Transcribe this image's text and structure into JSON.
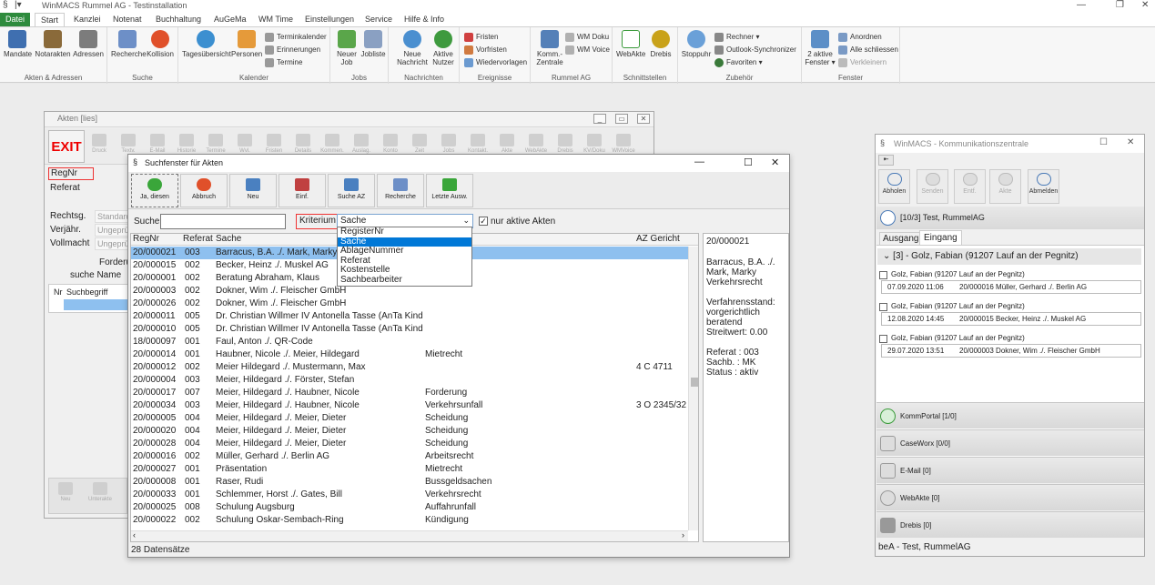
{
  "app": {
    "title": "WinMACS Rummel AG - Testinstallation",
    "tabs": [
      "Datei",
      "Start",
      "Kanzlei",
      "Notenat",
      "Buchhaltung",
      "AuGeMa",
      "WM Time",
      "Einstellungen",
      "Service",
      "Hilfe & Info"
    ]
  },
  "ribbon": {
    "akten_group": {
      "label": "Akten & Adressen",
      "buttons": [
        "Mandate",
        "Notarakten",
        "Adressen"
      ]
    },
    "suche_group": {
      "label": "Suche",
      "buttons": [
        "Recherche",
        "Kollision"
      ]
    },
    "kalender_group": {
      "label": "Kalender",
      "buttons": [
        "Tagesübersicht",
        "Personen"
      ],
      "small": [
        "Terminkalender",
        "Erinnerungen",
        "Termine"
      ]
    },
    "jobs_group": {
      "label": "Jobs",
      "buttons": [
        "Neuer Job",
        "Jobliste"
      ]
    },
    "nachrichten_group": {
      "label": "Nachrichten",
      "buttons": [
        "Neue Nachricht",
        "Aktive Nutzer"
      ]
    },
    "ereignisse_group": {
      "label": "Ereignisse",
      "small": [
        "Fristen",
        "Vorfristen",
        "Wiedervorlagen"
      ]
    },
    "rummel_group": {
      "label": "Rummel AG",
      "buttons": [
        "Komm.-Zentrale"
      ],
      "small": [
        "WM Doku",
        "WM Voice"
      ]
    },
    "schnitt_group": {
      "label": "Schnittstellen",
      "buttons": [
        "WebAkte",
        "Drebis"
      ]
    },
    "zubehoer_group": {
      "label": "Zubehör",
      "buttons": [
        "Stoppuhr"
      ],
      "small": [
        "Rechner",
        "Outlook-Synchronizer",
        "Favoriten"
      ]
    },
    "fenster_group": {
      "label": "Fenster",
      "buttons": [
        "2 aktive Fenster"
      ],
      "small": [
        "Anordnen",
        "Alle schliessen",
        "Verkleinern"
      ]
    }
  },
  "akten": {
    "title": "Akten [lies]",
    "exit": "EXIT",
    "toolbar": [
      "Druck",
      "Textv.",
      "E-Mail",
      "Historie",
      "Termine",
      "Wvl.",
      "Fristen",
      "Details",
      "Kommen.",
      "Auslag.",
      "Konto",
      "Zeit",
      "Jobs",
      "Kontakt.",
      "Akte",
      "WebAkte",
      "Drebis",
      "KV/Doku",
      "WMVoice"
    ],
    "labels": {
      "regnr": "RegNr",
      "referat": "Referat",
      "rechtsg": "Rechtsg.",
      "verjaehr": "Verjähr.",
      "vollmacht": "Vollmacht",
      "forderung": "Forderung",
      "suche_name": "suche Name",
      "nr": "Nr",
      "suchbegriff": "Suchbegriff"
    },
    "values": {
      "rechtsg": "Standard",
      "verjaehr": "Ungeprüft",
      "vollmacht": "Ungeprüft"
    },
    "bottom": [
      "Neu",
      "Unterakte"
    ]
  },
  "suchfenster": {
    "title": "Suchfenster für Akten",
    "toolbar": [
      "Ja, diesen",
      "Abbruch",
      "Neu",
      "Einf.",
      "Suche AZ",
      "Recherche",
      "Letzte Ausw."
    ],
    "suche_label": "Suche",
    "suche_value": "",
    "kriterium_label": "Kriterium",
    "kriterium_value": "Sache",
    "nur_aktive": "nur aktive Akten",
    "options": [
      "RegisterNr",
      "Sache",
      "AblageNummer",
      "Referat",
      "Kostenstelle",
      "Sachbearbeiter"
    ],
    "columns": {
      "regnr": "RegNr",
      "referat": "Referat",
      "sache": "Sache",
      "az": "AZ Gericht"
    },
    "rows": [
      {
        "regnr": "20/000021",
        "referat": "003",
        "sache": "Barracus, B.A. ./. Mark, Marky",
        "gegenstand": "",
        "az": ""
      },
      {
        "regnr": "20/000015",
        "referat": "002",
        "sache": "Becker, Heinz ./. Muskel AG",
        "gegenstand": "",
        "az": ""
      },
      {
        "regnr": "20/000001",
        "referat": "002",
        "sache": "Beratung Abraham, Klaus",
        "gegenstand": "",
        "az": ""
      },
      {
        "regnr": "20/000003",
        "referat": "002",
        "sache": "Dokner, Wim ./. Fleischer GmbH",
        "gegenstand": "",
        "az": ""
      },
      {
        "regnr": "20/000026",
        "referat": "002",
        "sache": "Dokner, Wim ./. Fleischer GmbH",
        "gegenstand": "",
        "az": ""
      },
      {
        "regnr": "20/000011",
        "referat": "005",
        "sache": "Dr. Christian Willmer IV Antonella Tasse (AnTa Kindern",
        "gegenstand": "",
        "az": ""
      },
      {
        "regnr": "20/000010",
        "referat": "005",
        "sache": "Dr. Christian Willmer IV Antonella Tasse (AnTa Kindern",
        "gegenstand": "",
        "az": ""
      },
      {
        "regnr": "18/000097",
        "referat": "001",
        "sache": "Faul, Anton ./. QR-Code",
        "gegenstand": "",
        "az": ""
      },
      {
        "regnr": "20/000014",
        "referat": "001",
        "sache": "Haubner, Nicole ./. Meier, Hildegard",
        "gegenstand": "Mietrecht",
        "az": ""
      },
      {
        "regnr": "20/000012",
        "referat": "002",
        "sache": "Meier Hildegard ./. Mustermann, Max",
        "gegenstand": "",
        "az": "4 C 4711"
      },
      {
        "regnr": "20/000004",
        "referat": "003",
        "sache": "Meier, Hildegard ./. Förster, Stefan",
        "gegenstand": "",
        "az": ""
      },
      {
        "regnr": "20/000017",
        "referat": "007",
        "sache": "Meier, Hildegard ./. Haubner, Nicole",
        "gegenstand": "Forderung",
        "az": ""
      },
      {
        "regnr": "20/000034",
        "referat": "003",
        "sache": "Meier, Hildegard ./. Haubner, Nicole",
        "gegenstand": "Verkehrsunfall",
        "az": "3 O 2345/32"
      },
      {
        "regnr": "20/000005",
        "referat": "004",
        "sache": "Meier, Hildegard ./. Meier, Dieter",
        "gegenstand": "Scheidung",
        "az": ""
      },
      {
        "regnr": "20/000020",
        "referat": "004",
        "sache": "Meier, Hildegard ./. Meier, Dieter",
        "gegenstand": "Scheidung",
        "az": ""
      },
      {
        "regnr": "20/000028",
        "referat": "004",
        "sache": "Meier, Hildegard ./. Meier, Dieter",
        "gegenstand": "Scheidung",
        "az": ""
      },
      {
        "regnr": "20/000016",
        "referat": "002",
        "sache": "Müller, Gerhard ./. Berlin AG",
        "gegenstand": "Arbeitsrecht",
        "az": ""
      },
      {
        "regnr": "20/000027",
        "referat": "001",
        "sache": "Präsentation",
        "gegenstand": "Mietrecht",
        "az": ""
      },
      {
        "regnr": "20/000008",
        "referat": "001",
        "sache": "Raser, Rudi",
        "gegenstand": "Bussgeldsachen",
        "az": ""
      },
      {
        "regnr": "20/000033",
        "referat": "001",
        "sache": "Schlemmer, Horst ./. Gates, Bill",
        "gegenstand": "Verkehrsrecht",
        "az": ""
      },
      {
        "regnr": "20/000025",
        "referat": "008",
        "sache": "Schulung Augsburg",
        "gegenstand": "Auffahrunfall",
        "az": ""
      },
      {
        "regnr": "20/000022",
        "referat": "002",
        "sache": "Schulung Oskar-Sembach-Ring",
        "gegenstand": "Kündigung",
        "az": ""
      }
    ],
    "detail": {
      "regnr": "20/000021",
      "sache": "Barracus, B.A. ./. Mark, Marky",
      "gegenstand": "Verkehrsrecht",
      "verfahren": "Verfahrensstand: vorgerichtlich beratend",
      "streitwert": "Streitwert: 0.00",
      "referat": "Referat : 003",
      "sachb": "Sachb. : MK",
      "status": "Status : aktiv"
    },
    "status": "28 Datensätze"
  },
  "komm": {
    "title": "WinMACS - Kommunikationszentrale",
    "buttons": [
      "Abholen",
      "Senden",
      "Entf.",
      "Akte",
      "Abmelden"
    ],
    "account": "[10/3] Test, RummelAG",
    "tabs": [
      "Ausgang",
      "Eingang"
    ],
    "group": "[3] - Golz, Fabian (91207 Lauf an der Pegnitz)",
    "messages": [
      {
        "from": "Golz, Fabian (91207 Lauf an der Pegnitz)",
        "date": "07.09.2020 11:06",
        "akte": "20/000016  Müller, Gerhard ./. Berlin AG"
      },
      {
        "from": "Golz, Fabian (91207 Lauf an der Pegnitz)",
        "date": "12.08.2020 14:45",
        "akte": "20/000015  Becker, Heinz ./. Muskel AG"
      },
      {
        "from": "Golz, Fabian (91207 Lauf an der Pegnitz)",
        "date": "29.07.2020 13:51",
        "akte": "20/000003  Dokner, Wim ./. Fleischer GmbH"
      }
    ],
    "channels": [
      "KommPortal [1/0]",
      "CaseWorx [0/0]",
      "E-Mail [0]",
      "WebAkte [0]",
      "Drebis [0]"
    ],
    "status": "beA - Test, RummelAG"
  },
  "colors": {
    "accent": "#2e8b3d",
    "selection": "#8ec0ef",
    "highlight": "#0078d7",
    "exit": "#e00000"
  }
}
